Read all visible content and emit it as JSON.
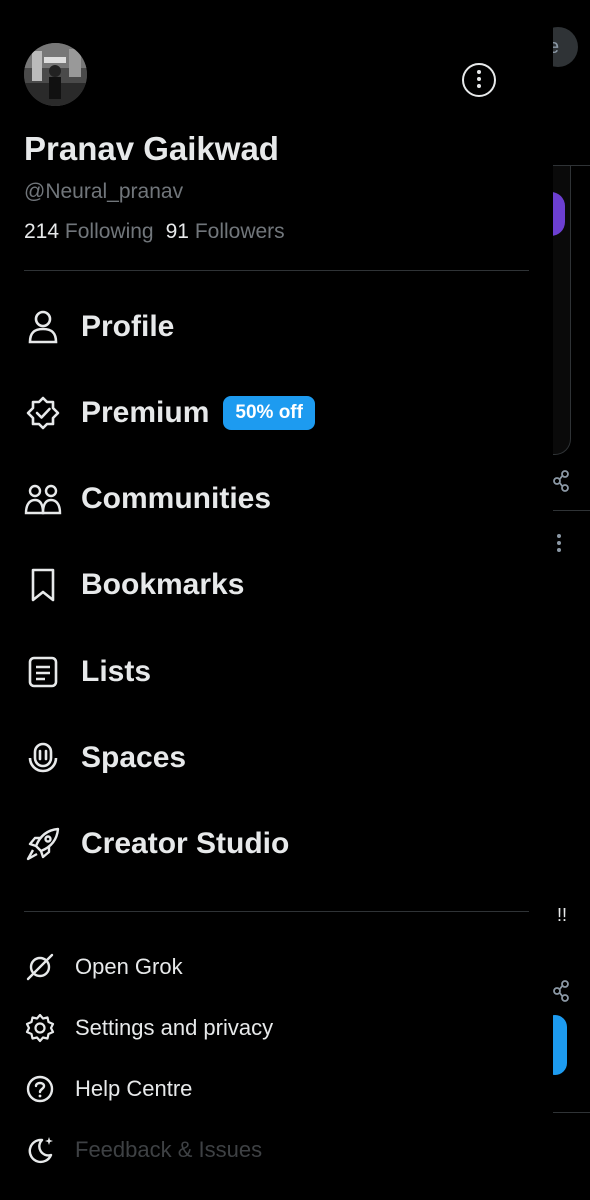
{
  "profile": {
    "name": "Pranav Gaikwad",
    "handle": "@Neural_pranav",
    "following_count": "214",
    "following_label": "Following",
    "followers_count": "91",
    "followers_label": "Followers"
  },
  "nav": {
    "items": [
      {
        "label": "Profile",
        "icon": "person-icon"
      },
      {
        "label": "Premium",
        "icon": "verified-badge-icon",
        "badge": "50% off"
      },
      {
        "label": "Communities",
        "icon": "communities-icon"
      },
      {
        "label": "Bookmarks",
        "icon": "bookmark-icon"
      },
      {
        "label": "Lists",
        "icon": "list-icon"
      },
      {
        "label": "Spaces",
        "icon": "spaces-icon"
      },
      {
        "label": "Creator Studio",
        "icon": "rocket-icon"
      }
    ]
  },
  "secondary": {
    "items": [
      {
        "label": "Open Grok",
        "icon": "grok-icon"
      },
      {
        "label": "Settings and privacy",
        "icon": "gear-icon"
      },
      {
        "label": "Help Centre",
        "icon": "help-icon"
      },
      {
        "label": "Feedback & Issues",
        "icon": "moon-sparkle-icon"
      }
    ]
  },
  "background": {
    "pill_text": "e",
    "alert_text": "!!"
  },
  "colors": {
    "background": "#000000",
    "text": "#e7e9ea",
    "muted": "#71767b",
    "accent": "#1d9bf0",
    "divider": "#2f3336"
  }
}
